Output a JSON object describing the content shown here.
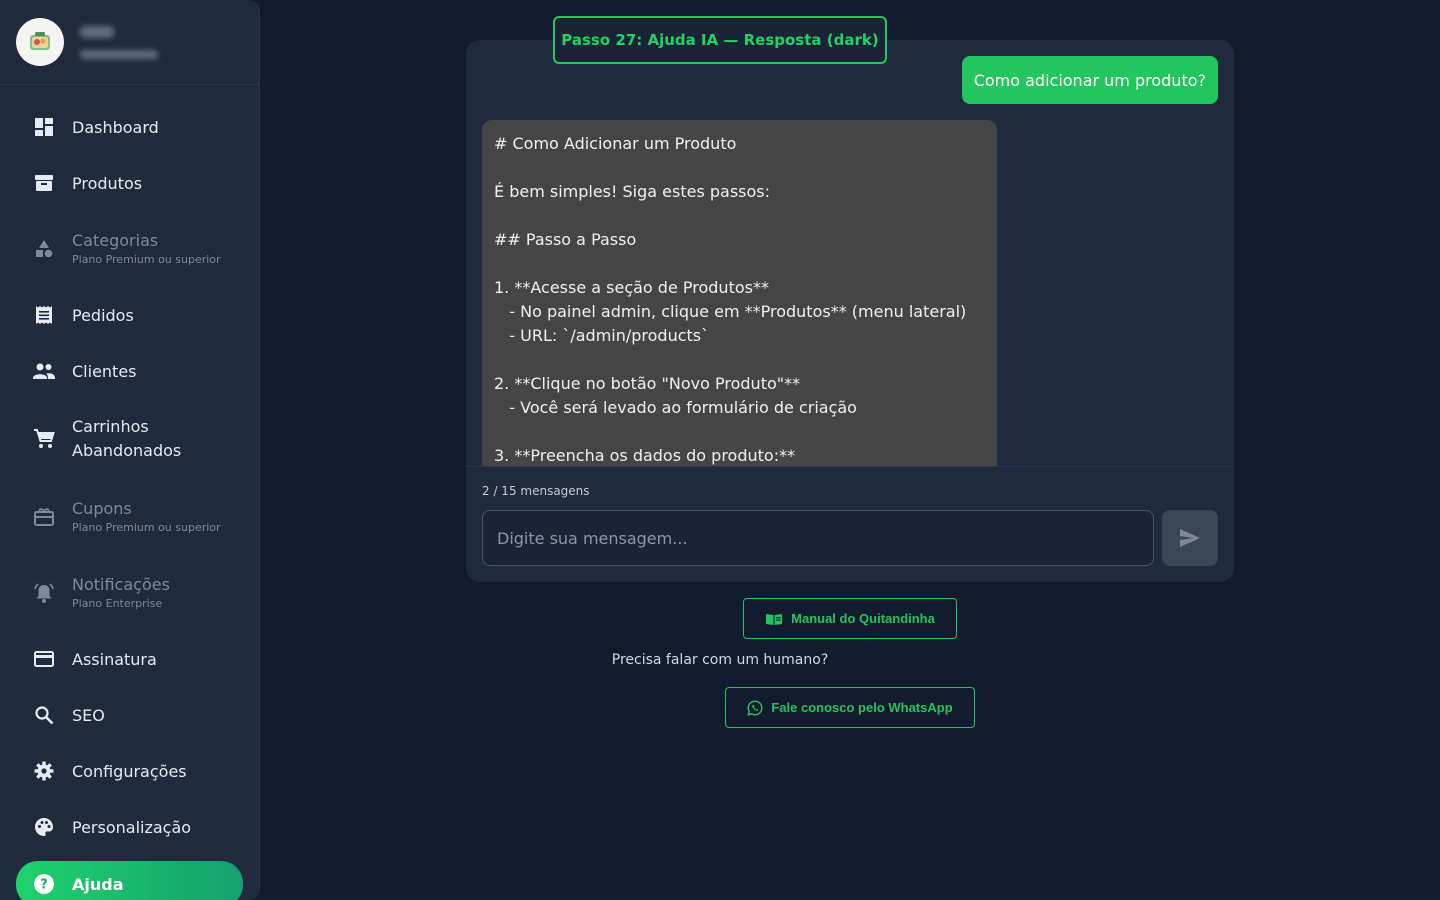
{
  "sidebar": {
    "profile": {
      "name": "",
      "role": ""
    },
    "items": [
      {
        "id": "dashboard",
        "label": "Dashboard",
        "icon": "dashboard-icon"
      },
      {
        "id": "produtos",
        "label": "Produtos",
        "icon": "archive-icon"
      },
      {
        "id": "categorias",
        "label": "Categorias",
        "sub": "Plano Premium ou superior",
        "icon": "category-icon"
      },
      {
        "id": "pedidos",
        "label": "Pedidos",
        "icon": "receipt-icon"
      },
      {
        "id": "clientes",
        "label": "Clientes",
        "icon": "people-icon"
      },
      {
        "id": "carrinhos",
        "label_line1": "Carrinhos",
        "label_line2": "Abandonados",
        "icon": "cart-icon"
      },
      {
        "id": "cupons",
        "label": "Cupons",
        "sub": "Plano Premium ou superior",
        "icon": "coupon-icon"
      },
      {
        "id": "notificacoes",
        "label": "Notificações",
        "sub": "Plano Enterprise",
        "icon": "bell-icon"
      },
      {
        "id": "assinatura",
        "label": "Assinatura",
        "icon": "card-icon"
      },
      {
        "id": "seo",
        "label": "SEO",
        "icon": "search-icon"
      },
      {
        "id": "configuracoes",
        "label": "Configurações",
        "icon": "gear-icon"
      },
      {
        "id": "personalizacao",
        "label": "Personalização",
        "icon": "palette-icon"
      },
      {
        "id": "ajuda",
        "label": "Ajuda",
        "icon": "help-icon",
        "active": true
      }
    ]
  },
  "step_badge": "Passo 27: Ajuda IA — Resposta (dark)",
  "chat": {
    "user_message": "Como adicionar um produto?",
    "ai_message": "# Como Adicionar um Produto\n\nÉ bem simples! Siga estes passos:\n\n## Passo a Passo\n\n1. **Acesse a seção de Produtos**\n   - No painel admin, clique em **Produtos** (menu lateral)\n   - URL: `/admin/products`\n\n2. **Clique no botão \"Novo Produto\"**\n   - Você será levado ao formulário de criação\n\n3. **Preencha os dados do produto:**",
    "counter": "2 / 15 mensagens",
    "input_placeholder": "Digite sua mensagem...",
    "input_value": ""
  },
  "help": {
    "manual_label": "Manual do Quitandinha",
    "human_prompt": "Precisa falar com um humano?",
    "whatsapp_label": "Fale conosco pelo WhatsApp"
  },
  "colors": {
    "accent": "#22c55e",
    "background": "#121a2e",
    "sidebar": "#1f2a3d",
    "ai_bubble": "#454545"
  }
}
